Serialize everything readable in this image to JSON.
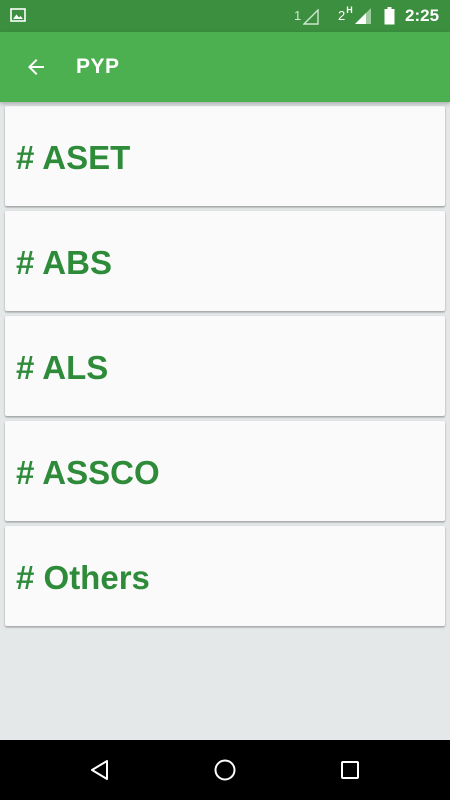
{
  "status_bar": {
    "sim1_label": "1",
    "sim2_label": "2",
    "sim2_network": "H",
    "time": "2:25",
    "icons": [
      "image-notification-icon",
      "signal-sim1-icon",
      "signal-sim2-icon",
      "battery-icon"
    ]
  },
  "app_bar": {
    "title": "PYP",
    "back_icon": "arrow-left-icon"
  },
  "items": [
    {
      "label": "# ASET"
    },
    {
      "label": "# ABS"
    },
    {
      "label": "# ALS"
    },
    {
      "label": "# ASSCO"
    },
    {
      "label": "# Others"
    }
  ],
  "nav_bar": {
    "icons": [
      "back-triangle-icon",
      "home-circle-icon",
      "recents-square-icon"
    ]
  },
  "colors": {
    "status_bar": "#3b8f3e",
    "app_bar": "#4caf50",
    "item_text": "#2e8b3a",
    "card_bg": "#fafafa",
    "page_bg": "#e4e8e8"
  }
}
